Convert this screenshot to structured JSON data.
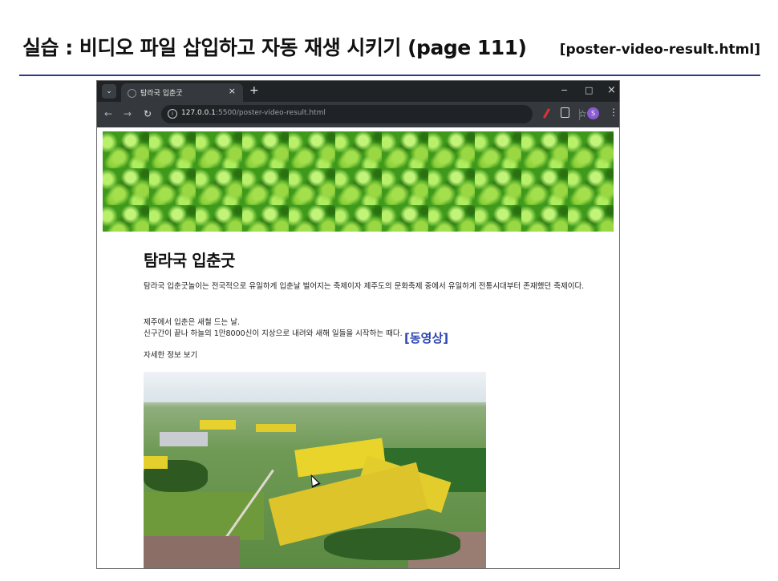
{
  "slide": {
    "title": "실습 : 비디오 파일 삽입하고 자동 재생 시키기 (page 111)",
    "file_label": "[poster-video-result.html]"
  },
  "browser": {
    "tab_title": "탐라국 입춘굿",
    "tab_close": "×",
    "new_tab": "+",
    "window_controls": {
      "minimize": "−",
      "maximize": "□",
      "close": "×"
    },
    "url_host": "127.0.0.1",
    "url_path": ":5500/poster-video-result.html",
    "profile_initial": "S",
    "icons": [
      "tab-menu-icon",
      "favicon-icon",
      "back-icon",
      "forward-icon",
      "reload-icon",
      "info-icon",
      "star-icon",
      "extension-icon",
      "puzzle-icon",
      "avatar-icon",
      "kebab-menu-icon"
    ]
  },
  "page": {
    "heading": "탐라국 입춘굿",
    "paragraph1": "탐라국 입춘굿놀이는 전국적으로 유일하게 입춘날 벌어지는 축제이자 제주도의 문화축제 중에서 유일하게 전통시대부터 존재했던 축제이다.",
    "paragraph2_line1": "제주에서 입춘은 새철 드는 날.",
    "paragraph2_line2": "신구간이 끝나 하늘의 1만8000신이 지상으로 내려와 새해 일들을 시작하는 때다.",
    "more_link": "자세한 정보 보기",
    "video_badge": "[동영상]"
  },
  "colors": {
    "rule": "#2d3a8c",
    "badge": "#2d45b0",
    "browser_chrome": "#1f2326"
  }
}
